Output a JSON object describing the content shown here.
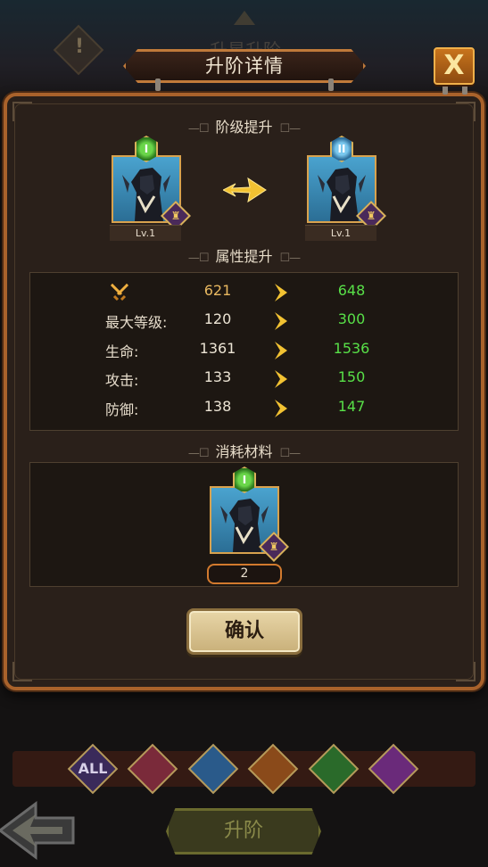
{
  "dialog": {
    "title": "升阶详情",
    "close_label": "X",
    "bg_title": "升星升阶"
  },
  "rank_section": {
    "header": "阶级提升",
    "from": {
      "rank": "I",
      "level": "Lv.1"
    },
    "to": {
      "rank": "II",
      "level": "Lv.1"
    }
  },
  "attr_section": {
    "header": "属性提升",
    "rows": [
      {
        "label": "",
        "icon": "crossed-swords-icon",
        "old": "621",
        "new": "648"
      },
      {
        "label": "最大等级:",
        "old": "120",
        "new": "300"
      },
      {
        "label": "生命:",
        "old": "1361",
        "new": "1536"
      },
      {
        "label": "攻击:",
        "old": "133",
        "new": "150"
      },
      {
        "label": "防御:",
        "old": "138",
        "new": "147"
      }
    ]
  },
  "material_section": {
    "header": "消耗材料",
    "item": {
      "rank": "I",
      "count": "2"
    }
  },
  "confirm_label": "确认",
  "bottom": {
    "filters": [
      {
        "label": "ALL",
        "icon": "all-filter-icon",
        "color": "#3a2a5a"
      },
      {
        "label": "",
        "icon": "demon-faction-icon",
        "color": "#7a2a3a"
      },
      {
        "label": "",
        "icon": "water-faction-icon",
        "color": "#2a5a8a"
      },
      {
        "label": "",
        "icon": "beast-faction-icon",
        "color": "#8a4a1a"
      },
      {
        "label": "",
        "icon": "forest-faction-icon",
        "color": "#2a6a2a"
      },
      {
        "label": "",
        "icon": "shadow-faction-icon",
        "color": "#6a2a7a"
      }
    ],
    "upgrade_label": "升阶"
  },
  "colors": {
    "panel_border": "#a9622b",
    "stat_new": "#58e048",
    "power_old": "#e8b860"
  }
}
